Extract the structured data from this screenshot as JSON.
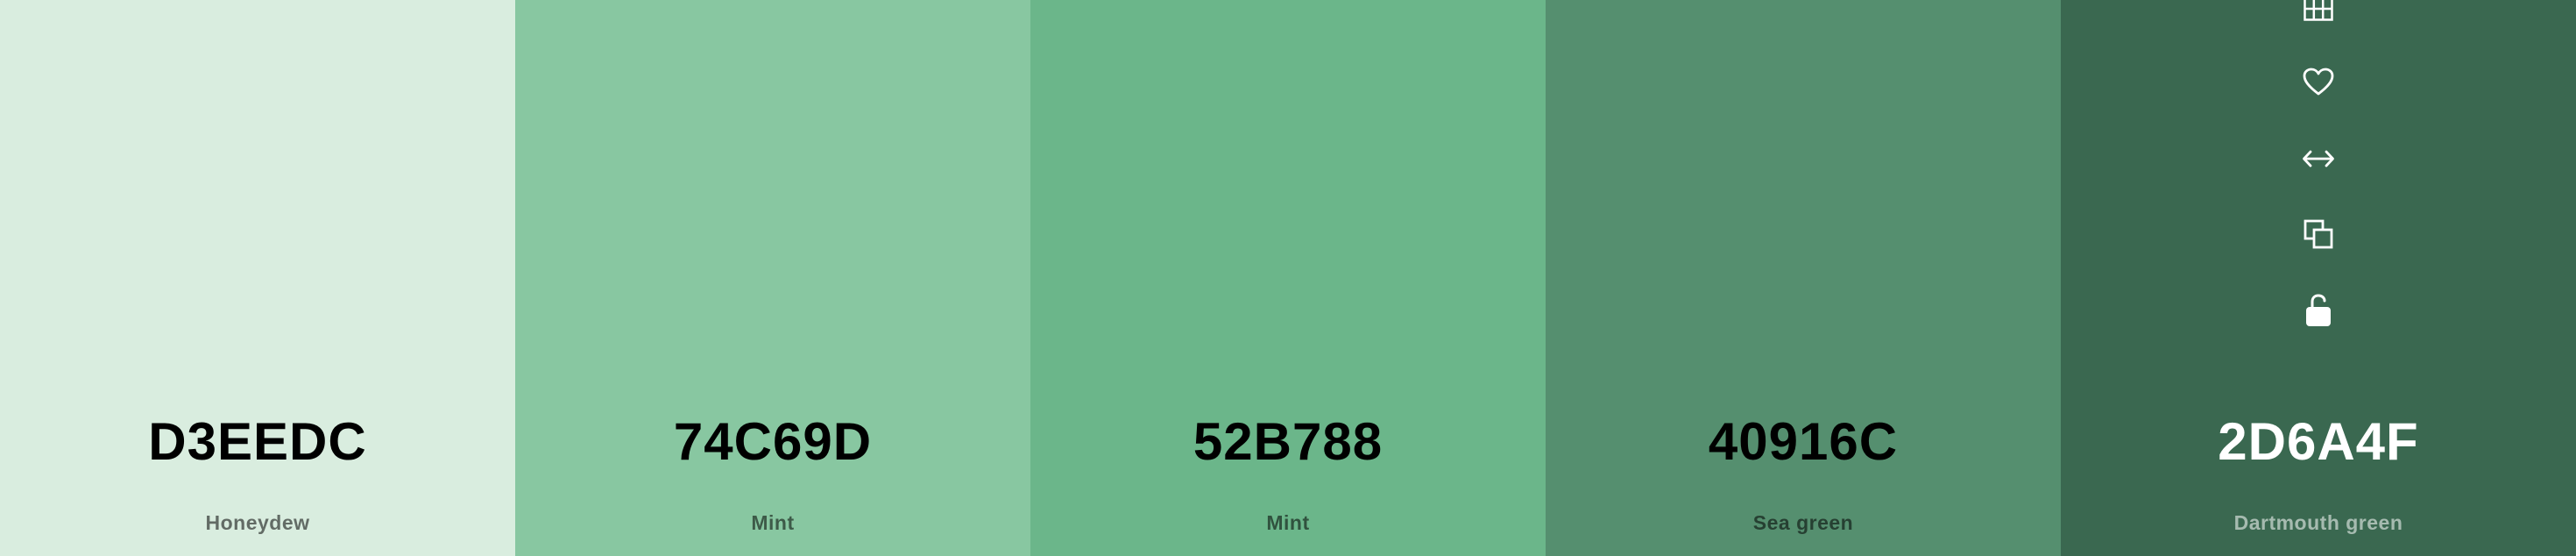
{
  "palette": {
    "swatches": [
      {
        "hex": "D3EEDC",
        "name": "Honeydew",
        "color": "#D9EDDF"
      },
      {
        "hex": "74C69D",
        "name": "Mint",
        "color": "#88C7A1"
      },
      {
        "hex": "52B788",
        "name": "Mint",
        "color": "#6BB68A"
      },
      {
        "hex": "40916C",
        "name": "Sea green",
        "color": "#558F6F"
      },
      {
        "hex": "2D6A4F",
        "name": "Dartmouth green",
        "color": "#3A6850"
      }
    ],
    "tools": [
      "grid-icon",
      "heart-icon",
      "arrows-horizontal-icon",
      "copy-icon",
      "lock-open-icon"
    ]
  }
}
